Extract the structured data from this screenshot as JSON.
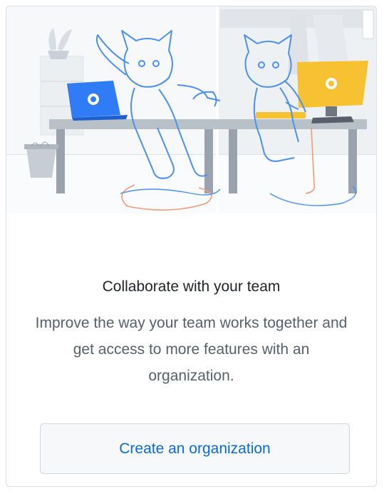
{
  "card": {
    "title": "Collaborate with your team",
    "description": "Improve the way your team works together and get access to more features with an organization.",
    "button_label": "Create an organization"
  },
  "colors": {
    "accent": "#0969da",
    "laptop_blue": "#2f7cf6",
    "monitor_yellow": "#f7c231",
    "outline_blue": "#4c8ff2",
    "cable_orange": "#f29a76"
  },
  "icons": [
    "plant-icon",
    "laptop-icon",
    "monitor-icon",
    "octocat-icon",
    "trash-can-icon"
  ]
}
